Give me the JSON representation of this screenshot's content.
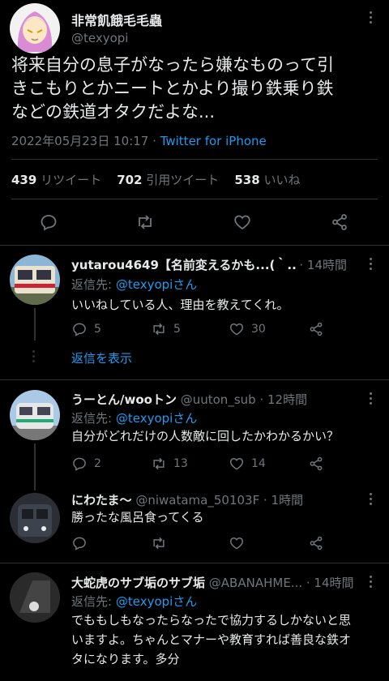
{
  "main_tweet": {
    "display_name": "非常飢餓毛毛蟲",
    "handle": "@texyopi",
    "text_lines": [
      "将来自分の息子がなったら嫌なものって引",
      "きこもりとかニートとかより撮り鉄乗り鉄",
      "などの鉄道オタクだよな..."
    ],
    "date": "2022年05月23日 10:17",
    "separator": "·",
    "source": "Twitter for iPhone",
    "stats": {
      "retweets_count": "439",
      "retweets_label": "リツイート",
      "quotes_count": "702",
      "quotes_label": "引用ツイート",
      "likes_count": "538",
      "likes_label": "いいね"
    }
  },
  "replies": [
    {
      "name": "yutarou4649【名前変えるかも...(｀...",
      "handle": "",
      "time": "· 14時間",
      "reply_to_label": "返信先:",
      "reply_to_handle": "@texyopiさん",
      "text_lines": [
        "いいねしている人、理由を教えてくれ。"
      ],
      "reply_count": "5",
      "retweet_count": "5",
      "like_count": "30",
      "show_replies": "返信を表示"
    },
    {
      "name": "うーとん/wooトン",
      "handle": "@uuton_sub",
      "time": "· 12時間",
      "reply_to_label": "返信先:",
      "reply_to_handle": "@texyopiさん",
      "text_lines": [
        "自分がどれだけの人数敵に回したかわかるかい？"
      ],
      "reply_count": "2",
      "retweet_count": "13",
      "like_count": "14"
    },
    {
      "name": "にわたま〜",
      "handle": "@niwatama_50103F",
      "time": "· 1時間",
      "text_lines": [
        "勝ったな風呂食ってくる"
      ],
      "reply_count": "",
      "retweet_count": "",
      "like_count": ""
    },
    {
      "name": "大蛇虎のサブ垢のサブ垢",
      "handle": "@ABANAHME...",
      "time": "· 14時間",
      "reply_to_label": "返信先:",
      "reply_to_handle": "@texyopiさん",
      "text_lines": [
        "でももしもなったらなったで協力するしかないと思",
        "いますよ。ちゃんとマナーや教育すれば善良な鉄オ",
        "タになります。多分"
      ]
    }
  ],
  "icons": [
    "reply-icon",
    "retweet-icon",
    "like-icon",
    "share-icon",
    "more-icon"
  ],
  "colors": {
    "background": "#000000",
    "text": "#e7e9ea",
    "muted": "#71767b",
    "link": "#1d9bf0",
    "divider": "#2f3336"
  }
}
